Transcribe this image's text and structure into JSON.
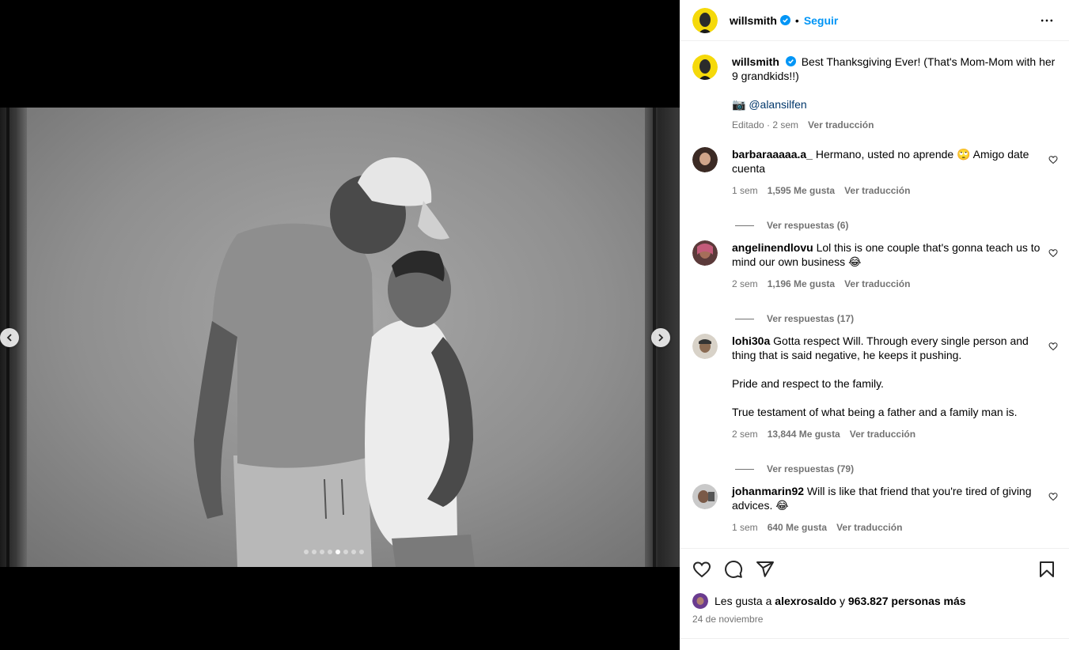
{
  "post": {
    "username": "willsmith",
    "follow_label": "Seguir",
    "separator": "•",
    "caption": {
      "text": "Best Thanksgiving Ever! (That's Mom-Mom with her 9 grandkids!!)",
      "credit_icon": "📷",
      "credit": "@alansilfen",
      "meta_edited": "Editado · 2 sem",
      "translate": "Ver traducción"
    },
    "carousel": {
      "total": 8,
      "active": 4
    }
  },
  "comments": [
    {
      "username": "barbaraaaaa.a_",
      "text": "Hermano, usted no aprende 🙄 Amigo date cuenta",
      "time": "1 sem",
      "likes": "1,595 Me gusta",
      "translate": "Ver traducción",
      "replies": "Ver respuestas (6)"
    },
    {
      "username": "angelinendlovu",
      "text": "Lol this is one couple that's gonna teach us to mind our own business 😂",
      "time": "2 sem",
      "likes": "1,196 Me gusta",
      "translate": "Ver traducción",
      "replies": "Ver respuestas (17)"
    },
    {
      "username": "lohi30a",
      "text": "Gotta respect Will. Through every single person and thing that is said negative, he keeps it pushing.",
      "text2": "Pride and respect to the family.",
      "text3": "True testament of what being a father and a family man is.",
      "time": "2 sem",
      "likes": "13,844 Me gusta",
      "translate": "Ver traducción",
      "replies": "Ver respuestas (79)"
    },
    {
      "username": "johanmarin92",
      "text": "Will is like that friend that you're tired of giving advices. 😂",
      "time": "1 sem",
      "likes": "640 Me gusta",
      "translate": "Ver traducción"
    }
  ],
  "likes": {
    "prefix": "Les gusta a",
    "user": "alexrosaldo",
    "conj": "y",
    "others": "963.827 personas más"
  },
  "date": "24 de noviembre",
  "icons": [
    "heart-icon",
    "comment-icon",
    "share-icon",
    "bookmark-icon",
    "more-icon",
    "verified-icon",
    "chevron-left-icon",
    "chevron-right-icon"
  ],
  "colors": {
    "link": "#0095f6",
    "secondary": "#737373",
    "verified": "#0095f6"
  }
}
